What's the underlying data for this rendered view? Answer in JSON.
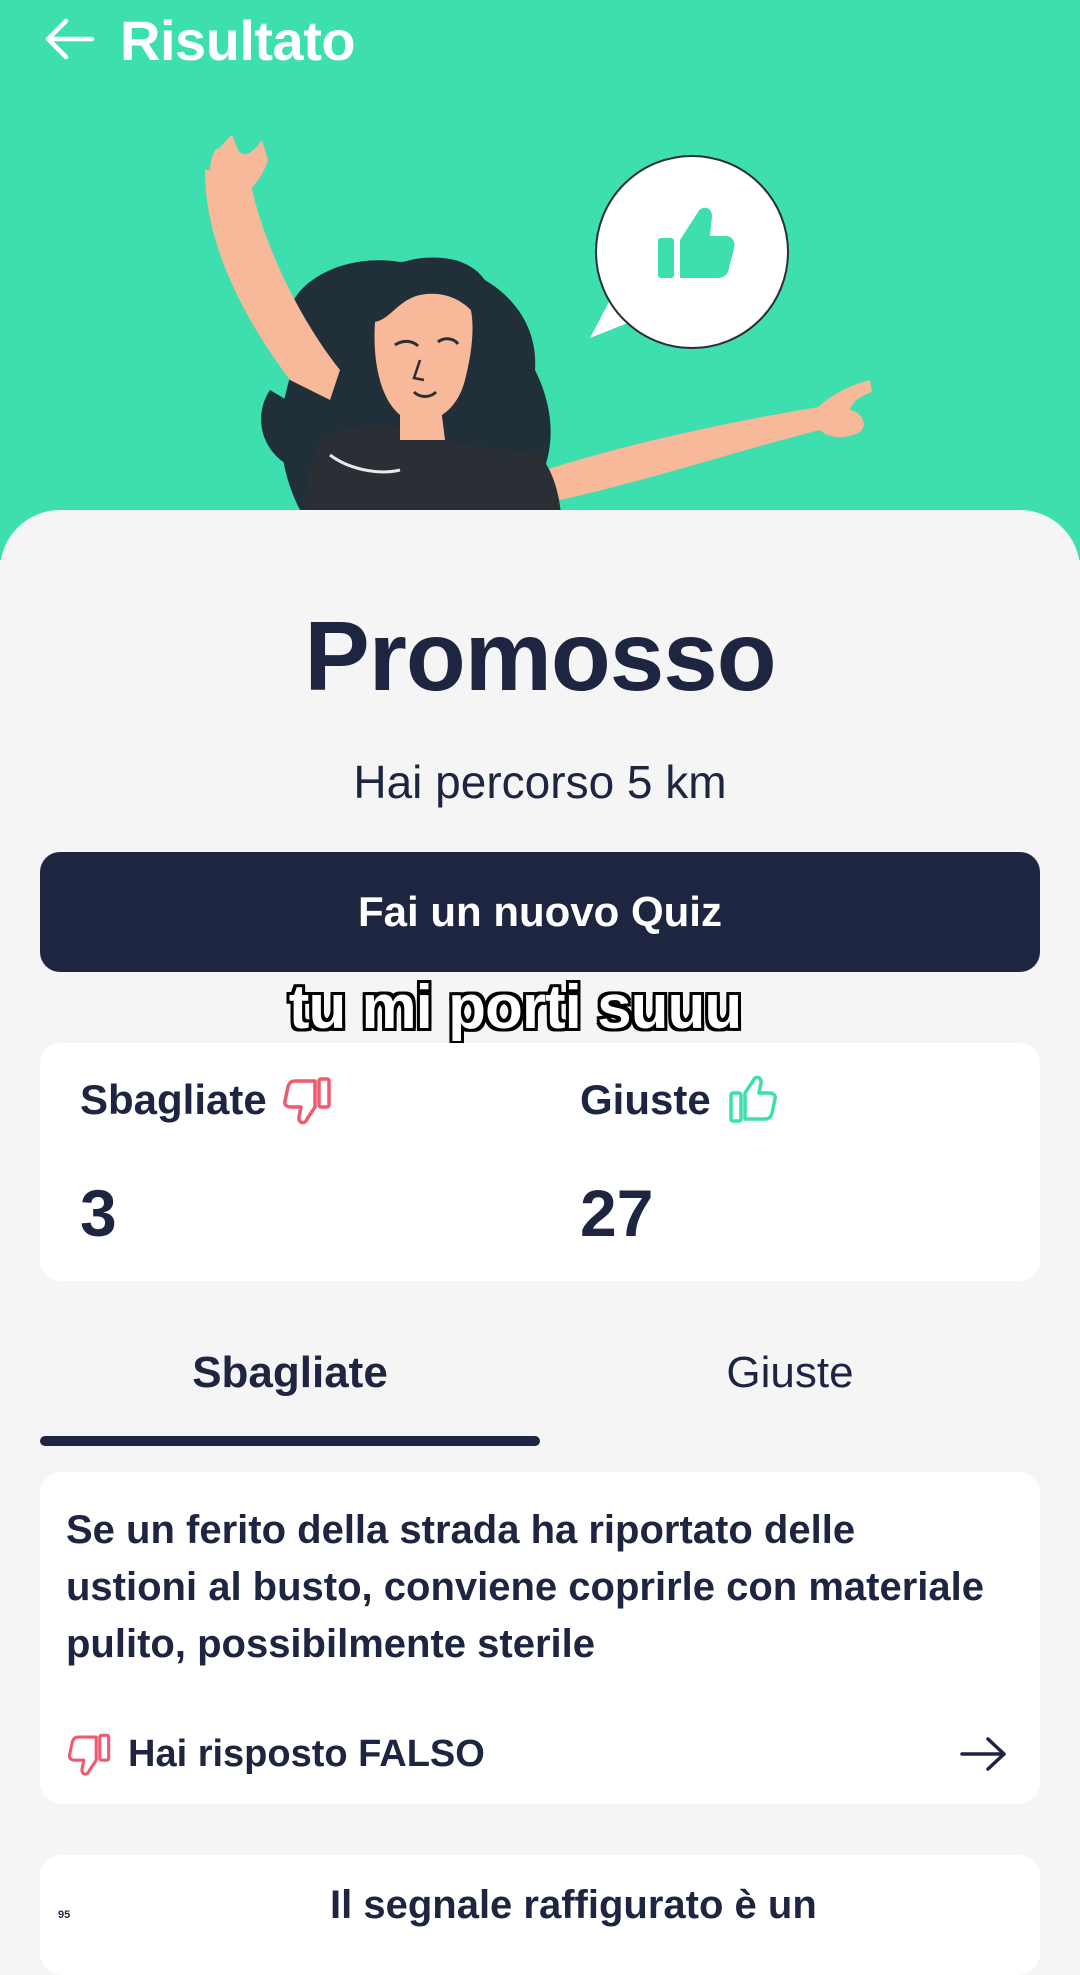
{
  "header": {
    "title": "Risultato"
  },
  "result": {
    "title": "Promosso",
    "subtitle": "Hai percorso 5 km",
    "new_quiz_label": "Fai un nuovo Quiz"
  },
  "caption": "tu mi porti suuu",
  "stats": {
    "wrong_label": "Sbagliate",
    "wrong_value": "3",
    "right_label": "Giuste",
    "right_value": "27"
  },
  "tabs": [
    {
      "label": "Sbagliate",
      "active": true
    },
    {
      "label": "Giuste",
      "active": false
    }
  ],
  "questions": [
    {
      "text": "Se un ferito della strada ha riportato delle ustioni al busto, conviene coprirle con materiale pulito, possibilmente sterile",
      "answer": "Hai risposto FALSO"
    },
    {
      "number": "95",
      "text": "Il segnale raffigurato è un"
    }
  ],
  "colors": {
    "hero_bg": "#3ddfae",
    "navy": "#1e2541",
    "wrong": "#ef5a6f",
    "right": "#3ddfae"
  },
  "icons": [
    "back-arrow-icon",
    "thumbs-up-icon",
    "thumbs-down-icon",
    "arrow-right-icon"
  ]
}
